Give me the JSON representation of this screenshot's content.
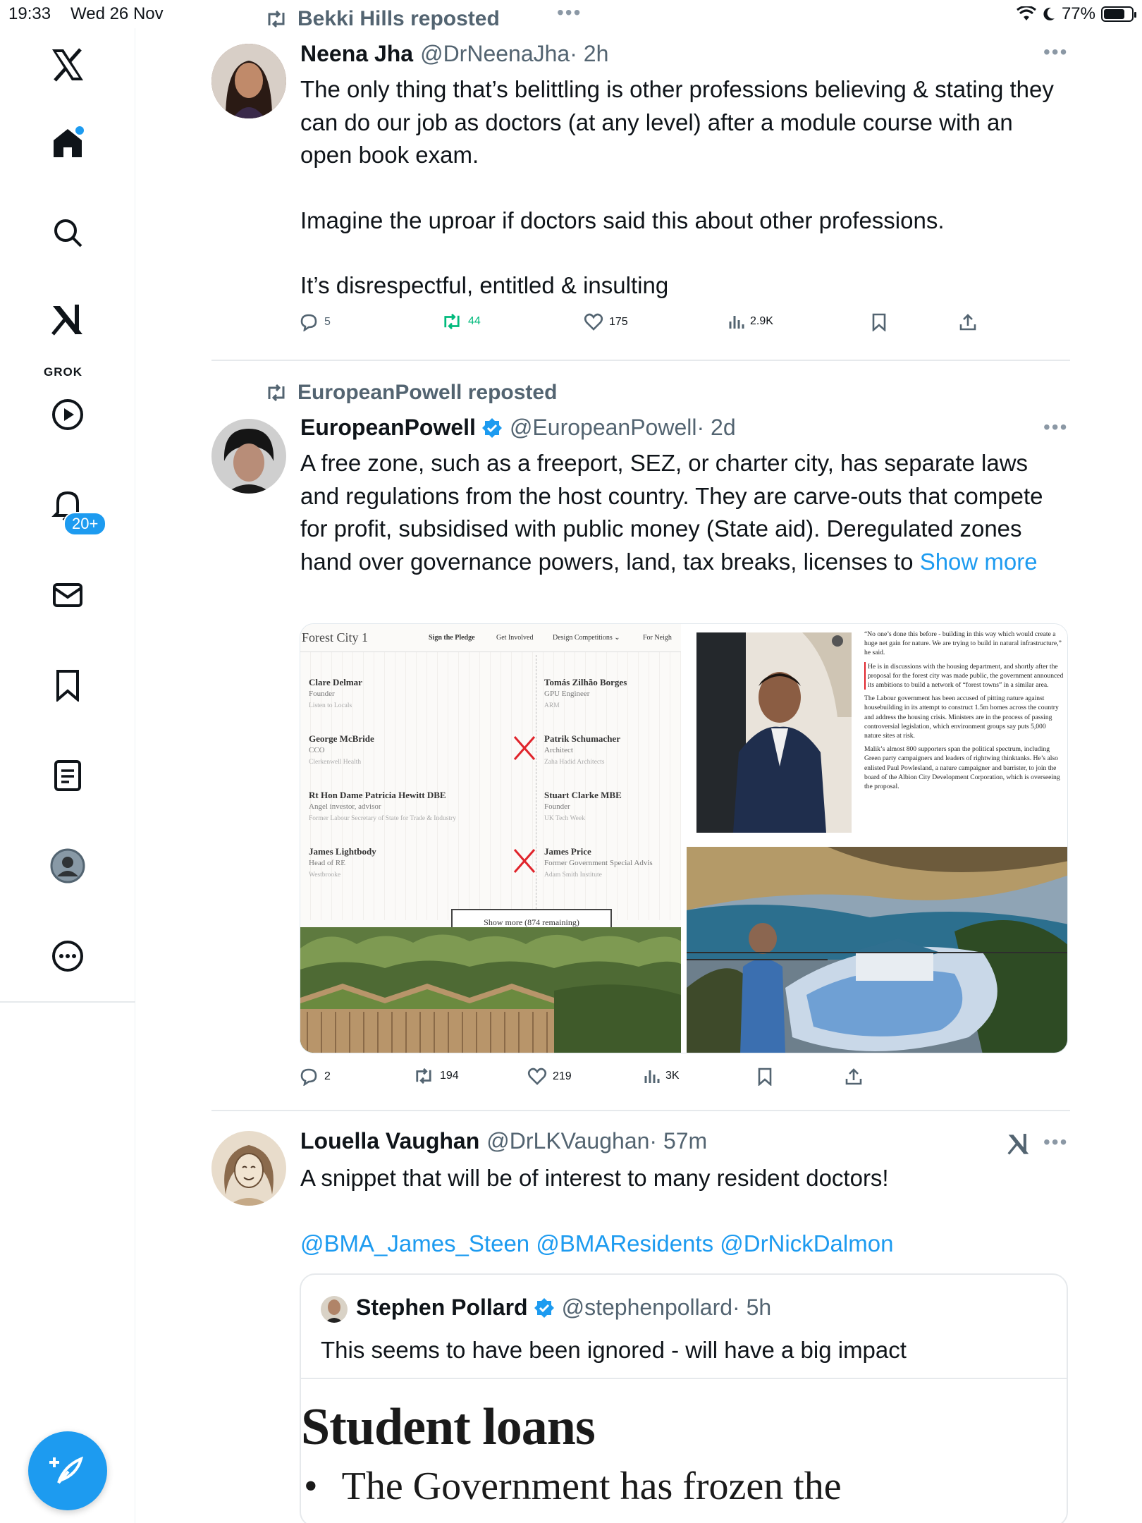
{
  "status_bar": {
    "time": "19:33",
    "date": "Wed 26 Nov",
    "battery": "77%",
    "battery_level": 0.77
  },
  "sidebar": {
    "notification_badge": "20+",
    "grok_label": "GROK"
  },
  "tweets": [
    {
      "reposted_by": "Bekki Hills reposted",
      "name": "Neena Jha",
      "handle": "@DrNeenaJha",
      "time": "· 2h",
      "paragraphs": [
        "The only thing that’s belittling is other professions believing & stating they can do our job as doctors (at any level) after a module course with an open book exam.",
        "",
        "Imagine the uproar if doctors said this about other professions.",
        "",
        "It’s disrespectful, entitled & insulting"
      ],
      "replies": "5",
      "reposts": "44",
      "likes": "175",
      "views": "2.9K"
    },
    {
      "reposted_by": "EuropeanPowell reposted",
      "name": "EuropeanPowell",
      "handle": "@EuropeanPowell",
      "time": "· 2d",
      "text": "A free zone, such as a freeport, SEZ, or charter city, has separate laws and regulations from the host country. They are carve-outs that compete for profit, subsidised with public money (State aid). Deregulated zones hand over governance powers, land, tax breaks, licenses to",
      "show_more": "Show more",
      "replies": "2",
      "reposts": "194",
      "likes": "219",
      "views": "3K",
      "media": {
        "site_title": "Forest City 1",
        "nav": [
          "Sign the Pledge",
          "Get Involved",
          "Design Competitions ⌄",
          "For Neigh"
        ],
        "people": [
          {
            "name": "Clare Delmar",
            "role": "Founder",
            "org": "Listen to Locals",
            "crossed": false
          },
          {
            "name": "Tomás Zilhão Borges",
            "role": "GPU Engineer",
            "org": "ARM",
            "crossed": false
          },
          {
            "name": "George McBride",
            "role": "CCO",
            "org": "Clerkenwell Health",
            "crossed": false
          },
          {
            "name": "Patrik Schumacher",
            "role": "Architect",
            "org": "Zaha Hadid Architects",
            "crossed": true
          },
          {
            "name": "Rt Hon Dame Patricia Hewitt DBE",
            "role": "Angel investor, advisor",
            "org": "Former Labour Secretary of State for Trade & Industry",
            "crossed": false
          },
          {
            "name": "Stuart Clarke MBE",
            "role": "Founder",
            "org": "UK Tech Week",
            "crossed": false
          },
          {
            "name": "James Lightbody",
            "role": "Head of RE",
            "org": "Westbrooke",
            "crossed": false
          },
          {
            "name": "James Price",
            "role": "Former Government Special Advis",
            "org": "Adam Smith Institute",
            "crossed": true
          }
        ],
        "show_more_button": "Show more (874 remaining)",
        "article": [
          "“No one’s done this before - building in this way which would create a huge net gain for nature. We are trying to build in natural infrastructure,” he said.",
          "He is in discussions with the housing department, and shortly after the proposal for the forest city was made public, the government announced its ambitions to build a network of “forest towns” in a similar area.",
          "The Labour government has been accused of pitting nature against housebuilding in its attempt to construct 1.5m homes across the country and address the housing crisis. Ministers are in the process of passing controversial legislation, which environment groups say puts 5,000 nature sites at risk.",
          "Malik’s almost 800 supporters span the political spectrum, including Green party campaigners and leaders of rightwing thinktanks. He’s also enlisted Paul Powlesland, a nature campaigner and barrister, to join the board of the Albion City Development Corporation, which is overseeing the proposal."
        ]
      }
    },
    {
      "name": "Louella Vaughan",
      "handle": "@DrLKVaughan",
      "time": "· 57m",
      "text": "A snippet that will be of interest to many resident doctors!",
      "mentions": "@BMA_James_Steen @BMAResidents @DrNickDalmon",
      "quote": {
        "name": "Stephen Pollard",
        "handle": "@stephenpollard",
        "time": "· 5h",
        "text": "This seems to have been ignored - will have a big impact",
        "image_heading": "Student loans",
        "image_bullet": "The Government has frozen the"
      }
    }
  ],
  "colors": {
    "accent": "#1d9bf0",
    "repost_green": "#00ba7c",
    "muted": "#536471",
    "crossout_red": "#e0242b"
  }
}
